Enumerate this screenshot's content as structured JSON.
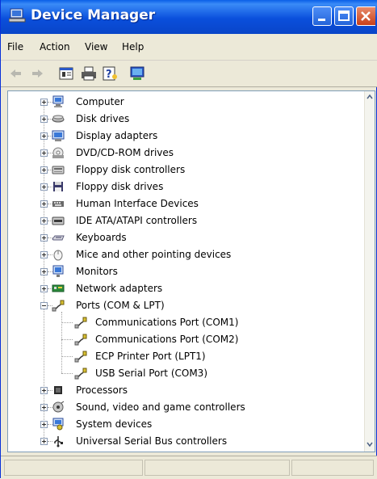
{
  "window": {
    "title": "Device Manager"
  },
  "menu": [
    "File",
    "Action",
    "View",
    "Help"
  ],
  "toolbar": {
    "items": [
      {
        "name": "back-icon"
      },
      {
        "name": "forward-icon"
      },
      {
        "name": "properties-icon"
      },
      {
        "name": "print-icon"
      },
      {
        "name": "help-icon"
      },
      {
        "name": "update-driver-icon"
      }
    ]
  },
  "tree": {
    "nodes": [
      {
        "label": "Computer",
        "icon": "computer-icon",
        "expanded": false
      },
      {
        "label": "Disk drives",
        "icon": "disk-drive-icon",
        "expanded": false
      },
      {
        "label": "Display adapters",
        "icon": "display-adapter-icon",
        "expanded": false
      },
      {
        "label": "DVD/CD-ROM drives",
        "icon": "dvd-drive-icon",
        "expanded": false
      },
      {
        "label": "Floppy disk controllers",
        "icon": "floppy-controller-icon",
        "expanded": false
      },
      {
        "label": "Floppy disk drives",
        "icon": "floppy-drive-icon",
        "expanded": false
      },
      {
        "label": "Human Interface Devices",
        "icon": "hid-icon",
        "expanded": false
      },
      {
        "label": "IDE ATA/ATAPI controllers",
        "icon": "ide-controller-icon",
        "expanded": false
      },
      {
        "label": "Keyboards",
        "icon": "keyboard-icon",
        "expanded": false
      },
      {
        "label": "Mice and other pointing devices",
        "icon": "mouse-icon",
        "expanded": false
      },
      {
        "label": "Monitors",
        "icon": "monitor-icon",
        "expanded": false
      },
      {
        "label": "Network adapters",
        "icon": "network-adapter-icon",
        "expanded": false
      },
      {
        "label": "Ports (COM & LPT)",
        "icon": "port-icon",
        "expanded": true,
        "children": [
          {
            "label": "Communications Port (COM1)",
            "icon": "port-icon"
          },
          {
            "label": "Communications Port (COM2)",
            "icon": "port-icon"
          },
          {
            "label": "ECP Printer Port (LPT1)",
            "icon": "port-icon"
          },
          {
            "label": "USB Serial Port (COM3)",
            "icon": "port-icon"
          }
        ]
      },
      {
        "label": "Processors",
        "icon": "processor-icon",
        "expanded": false
      },
      {
        "label": "Sound, video and game controllers",
        "icon": "sound-icon",
        "expanded": false
      },
      {
        "label": "System devices",
        "icon": "system-device-icon",
        "expanded": false
      },
      {
        "label": "Universal Serial Bus controllers",
        "icon": "usb-icon",
        "expanded": false
      }
    ]
  },
  "colors": {
    "titlebar": "#0a4fdc",
    "window_bg": "#ece9d8",
    "tree_bg": "#ffffff",
    "border": "#7f9db9"
  }
}
